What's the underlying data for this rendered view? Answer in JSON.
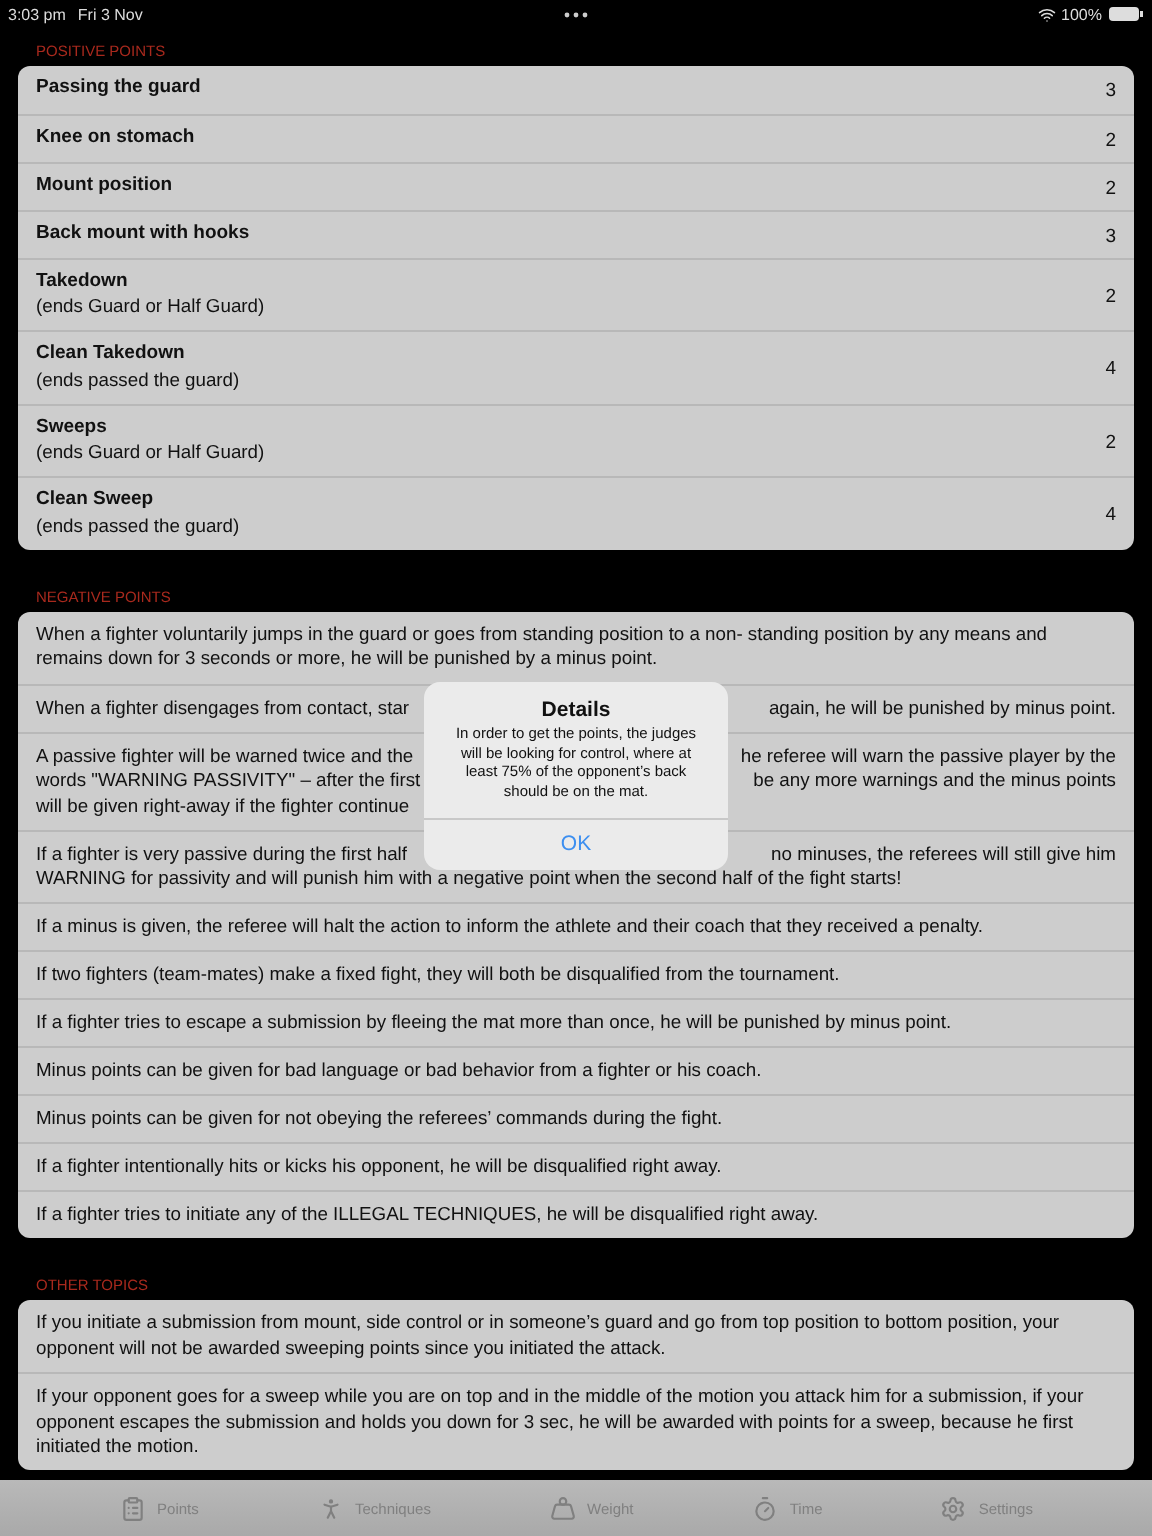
{
  "status_bar": {
    "time": "3:03 pm",
    "date": "Fri 3 Nov",
    "battery": "100%"
  },
  "sections": [
    {
      "title": "POSITIVE POINTS",
      "kind": "points",
      "rows": [
        {
          "name": "Passing the guard",
          "points": "3"
        },
        {
          "name": "Knee on stomach",
          "points": "2"
        },
        {
          "name": "Mount position",
          "points": "2"
        },
        {
          "name": "Back mount with hooks",
          "points": "3"
        },
        {
          "name": "Takedown",
          "note": "(ends Guard or Half Guard)",
          "points": "2"
        },
        {
          "name": "Clean Takedown",
          "note": "(ends passed the guard)",
          "points": "4"
        },
        {
          "name": "Sweeps",
          "note": "(ends Guard or Half Guard)",
          "points": "2"
        },
        {
          "name": "Clean Sweep",
          "note": "(ends passed the guard)",
          "points": "4"
        }
      ]
    },
    {
      "title": "NEGATIVE POINTS",
      "kind": "rules",
      "rows": [
        {
          "text": "When a fighter voluntarily jumps in the guard or goes from standing position to a non- standing position by any means and remains down for 3 seconds or more, he will be punished by a minus point."
        },
        {
          "lines": [
            {
              "left": "When a fighter disengages from contact, star",
              "right": "again, he will be punished by minus point."
            }
          ]
        },
        {
          "lines": [
            {
              "left": "A passive fighter will be warned twice and the",
              "right": "he referee will warn the passive player by the"
            },
            {
              "left": "words \"WARNING PASSIVITY\" – after the first",
              "right": "be any more warnings and the minus points"
            },
            {
              "left": "will be given right-away if the fighter continue"
            }
          ]
        },
        {
          "lines": [
            {
              "left": "If a fighter is very passive during the first half",
              "right": "no minuses, the referees will still give him"
            },
            {
              "left": "WARNING for passivity and will punish him with a negative point when the second half of the fight starts!"
            }
          ]
        },
        {
          "text": "If a minus is given, the referee will halt the action to inform the athlete and their coach that they received a penalty."
        },
        {
          "text": "If two fighters (team-mates) make a fixed fight, they will both be disqualified from the tournament."
        },
        {
          "text": "If a fighter tries to escape a submission by fleeing the mat more than once, he will be punished by minus point."
        },
        {
          "text": "Minus points can be given for bad language or bad behavior from a fighter or his coach."
        },
        {
          "text": "Minus points can be given for not obeying the referees’ commands during the fight."
        },
        {
          "text": "If a fighter intentionally hits or kicks his opponent, he will be disqualified right away."
        },
        {
          "text": "If a fighter tries to initiate any of the ILLEGAL TECHNIQUES, he will be disqualified right away."
        }
      ]
    },
    {
      "title": "OTHER TOPICS",
      "kind": "rules",
      "rows": [
        {
          "text": "If you initiate a submission from mount, side control or in someone’s guard and go from top position to bottom position, your opponent will not be awarded sweeping points since you initiated the attack."
        },
        {
          "text": "If your opponent goes for a sweep while you are on top and in the middle of the motion you attack him for a submission, if your opponent escapes the submission and holds you down for 3 sec, he will be awarded with points for a sweep, because he first initiated the motion."
        }
      ]
    }
  ],
  "alert": {
    "title": "Details",
    "message": "In order to get the points, the judges will be looking for control, where at least 75% of the opponent’s back should be on the mat.",
    "button": "OK"
  },
  "tabs": [
    {
      "label": "Points",
      "selected": false
    },
    {
      "label": "Techniques",
      "selected": false
    },
    {
      "label": "Weight",
      "selected": false
    },
    {
      "label": "Time",
      "selected": false
    },
    {
      "label": "Settings",
      "selected": false
    }
  ]
}
